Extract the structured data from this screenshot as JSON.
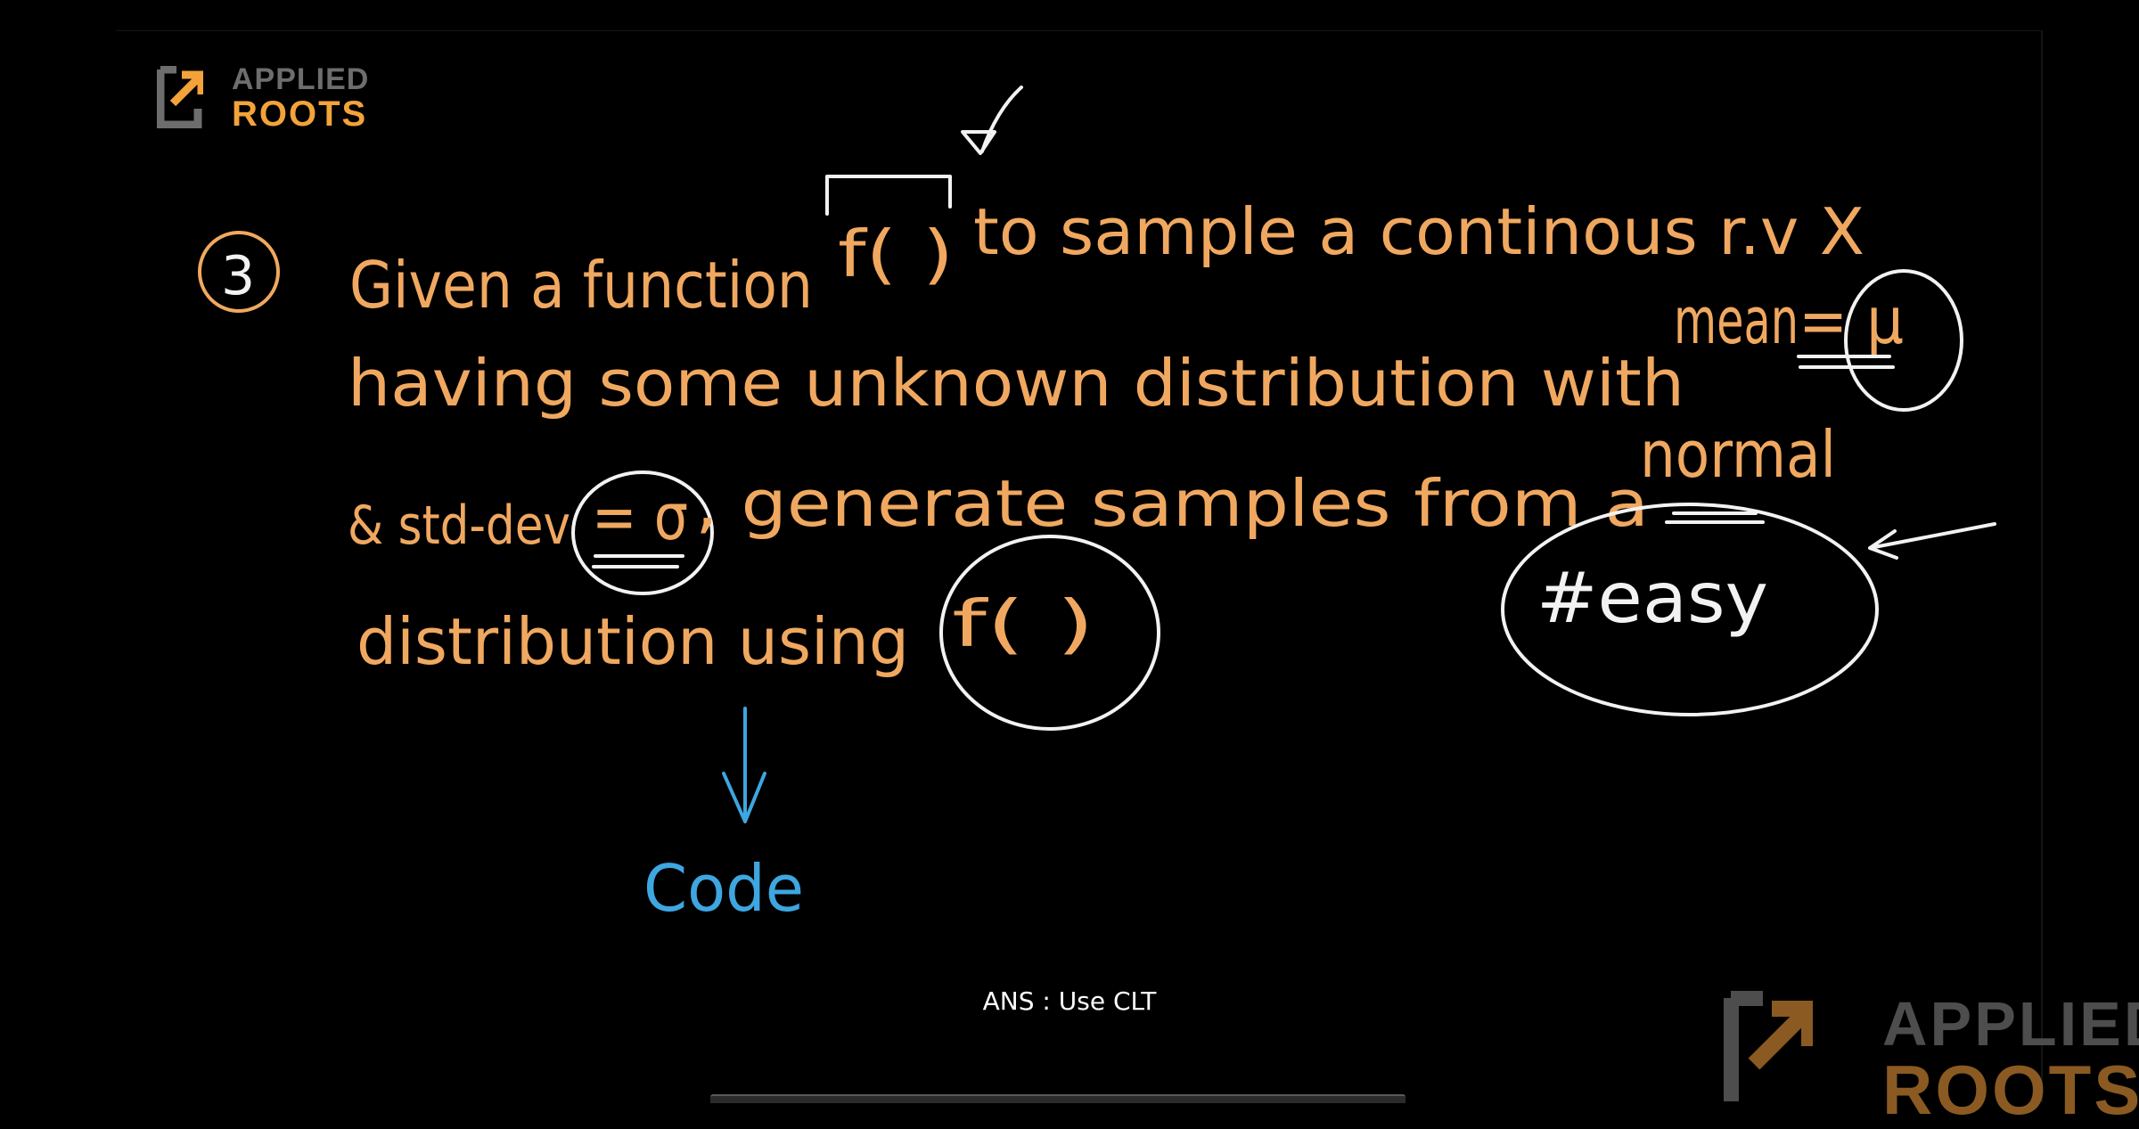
{
  "logo": {
    "line1": "APPLIED",
    "line2": "ROOTS"
  },
  "watermark": {
    "line1": "APPLIED",
    "line2": "ROOTS"
  },
  "board": {
    "number": "3",
    "line1a": "Given a function",
    "line1b": "f( )",
    "line1c": "to sample a continous r.v X",
    "line2a": "having some unknown distribution with",
    "line2b": "mean",
    "line2c": "= μ",
    "line3a": "& std-dev",
    "line3b": "= σ",
    "line3c": ", generate samples from a",
    "line3d": "normal",
    "line4a": "distribution using",
    "line4b": "f( )",
    "tag": "#easy",
    "code": "Code"
  },
  "caption": "ANS : Use CLT",
  "colors": {
    "ink_orange": "#f0a860",
    "ink_white": "#f2f2f2",
    "ink_blue": "#3ea6e0",
    "brand_orange": "#f3a33a"
  }
}
